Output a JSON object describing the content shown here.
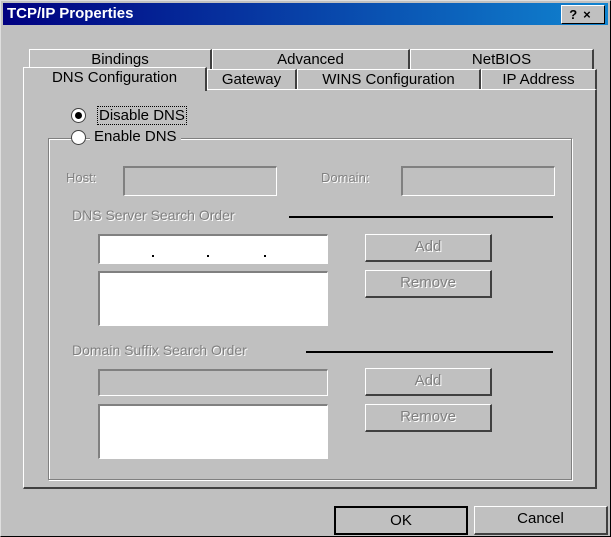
{
  "window": {
    "title": "TCP/IP Properties",
    "help_glyph": "?",
    "close_glyph": "×"
  },
  "tabs_back": [
    "Bindings",
    "Advanced",
    "NetBIOS"
  ],
  "tabs_front": [
    "DNS Configuration",
    "Gateway",
    "WINS Configuration",
    "IP Address"
  ],
  "active_tab": "DNS Configuration",
  "dns": {
    "disable_label": "Disable DNS",
    "enable_label": "Enable DNS",
    "selected": "disable",
    "host_label": "Host:",
    "host_value": "",
    "domain_label": "Domain:",
    "domain_value": "",
    "server_order_label": "DNS Server Search Order",
    "add_label": "Add",
    "remove_label": "Remove",
    "suffix_order_label": "Domain Suffix Search Order",
    "add2_label": "Add",
    "remove2_label": "Remove"
  },
  "footer": {
    "ok_label": "OK",
    "cancel_label": "Cancel"
  }
}
